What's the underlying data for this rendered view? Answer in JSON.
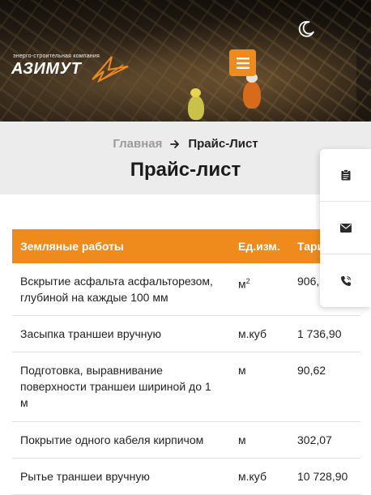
{
  "header": {
    "logo": {
      "tagline": "энерго-строительная компания",
      "name": "АЗИМУТ"
    },
    "menu_icon": "hamburger-icon",
    "theme_icon": "moon-icon",
    "accent_color": "#ef8b1d"
  },
  "breadcrumb": {
    "home": "Главная",
    "separator_icon": "arrow-right-icon",
    "current": "Прайс-Лист"
  },
  "page": {
    "title": "Прайс-лист"
  },
  "price_table": {
    "headers": [
      "Земляные работы",
      "Ед.изм.",
      "Тари"
    ],
    "rows": [
      {
        "name": "Вскрытие асфальта асфальторезом, глубиной на каждые 100 мм",
        "unit": "м",
        "unit_sup": "2",
        "price": "906,..."
      },
      {
        "name": "Засыпка траншеи вручную",
        "unit": "м.куб",
        "unit_sup": "",
        "price": "1 736,90"
      },
      {
        "name": "Подготовка, выравнивание поверхности траншеи шириной до 1 м",
        "unit": "м",
        "unit_sup": "",
        "price": "90,62"
      },
      {
        "name": "Покрытие одного кабеля кирпичом",
        "unit": "м",
        "unit_sup": "",
        "price": "302,07"
      },
      {
        "name": "Рытье траншеи вручную",
        "unit": "м.куб",
        "unit_sup": "",
        "price": "10 728,90"
      }
    ]
  },
  "side_panel": {
    "items": [
      {
        "icon": "clipboard-icon"
      },
      {
        "icon": "envelope-icon"
      },
      {
        "icon": "phone-icon"
      }
    ]
  }
}
